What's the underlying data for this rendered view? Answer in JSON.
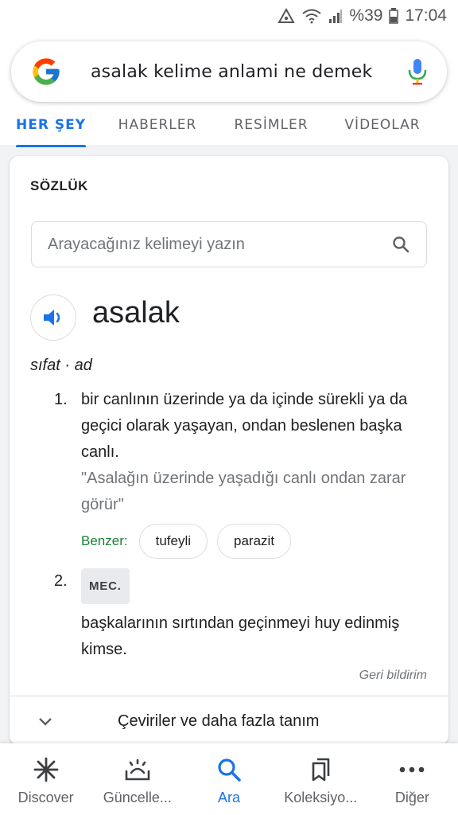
{
  "status": {
    "battery": "%39",
    "time": "17:04"
  },
  "search": {
    "query": "asalak kelime anlami ne demek"
  },
  "tabs": [
    "HER ŞEY",
    "HABERLER",
    "RESİMLER",
    "VİDEOLAR"
  ],
  "dictionary": {
    "title": "SÖZLÜK",
    "search_placeholder": "Arayacağınız kelimeyi yazın",
    "word": "asalak",
    "part_of_speech": "sıfat · ad",
    "definitions": [
      {
        "number": "1.",
        "text": "bir canlının üzerinde ya da içinde sürekli ya da geçici olarak yaşayan, ondan beslenen başka canlı.",
        "example": "\"Asalağın üzerinde yaşadığı canlı ondan zarar görür\"",
        "similar_label": "Benzer:",
        "similar": [
          "tufeyli",
          "parazit"
        ]
      },
      {
        "number": "2.",
        "tag": "MEC.",
        "text": "başkalarının sırtından geçinmeyi huy edinmiş kimse."
      }
    ],
    "feedback": "Geri bildirim",
    "more": "Çeviriler ve daha fazla tanım"
  },
  "bottom_nav": [
    {
      "label": "Discover",
      "icon": "asterisk-icon"
    },
    {
      "label": "Güncelle...",
      "icon": "updates-icon"
    },
    {
      "label": "Ara",
      "icon": "search-icon"
    },
    {
      "label": "Koleksiyo...",
      "icon": "bookmarks-icon"
    },
    {
      "label": "Diğer",
      "icon": "more-dots-icon"
    }
  ],
  "colors": {
    "accent": "#1a73e8",
    "similar_label": "#188038"
  }
}
